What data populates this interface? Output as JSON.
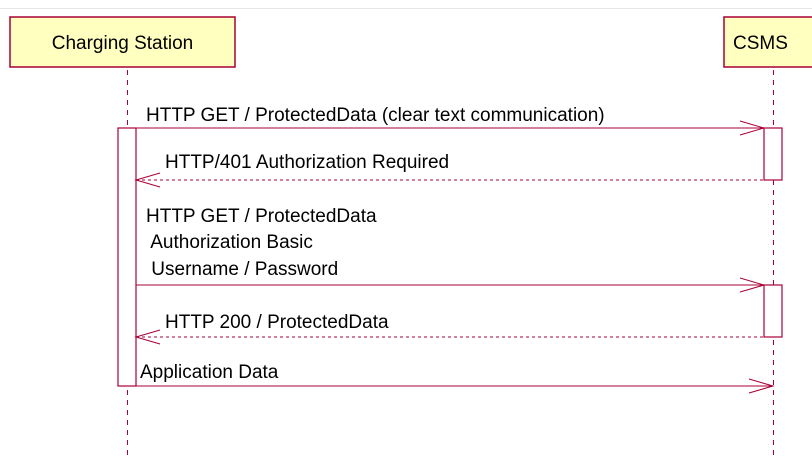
{
  "colors": {
    "box_fill": "#ffffc0",
    "line": "#a80036"
  },
  "participants": {
    "charging_station": "Charging Station",
    "csms": "CSMS"
  },
  "messages": [
    {
      "lines": [
        "HTTP GET / ProtectedData (clear text communication)"
      ],
      "direction": "request"
    },
    {
      "lines": [
        "HTTP/401 Authorization Required"
      ],
      "direction": "response"
    },
    {
      "lines": [
        "HTTP GET / ProtectedData",
        " Authorization Basic",
        " Username / Password"
      ],
      "direction": "request"
    },
    {
      "lines": [
        "HTTP 200 / ProtectedData"
      ],
      "direction": "response"
    },
    {
      "lines": [
        "Application Data"
      ],
      "direction": "request"
    }
  ]
}
